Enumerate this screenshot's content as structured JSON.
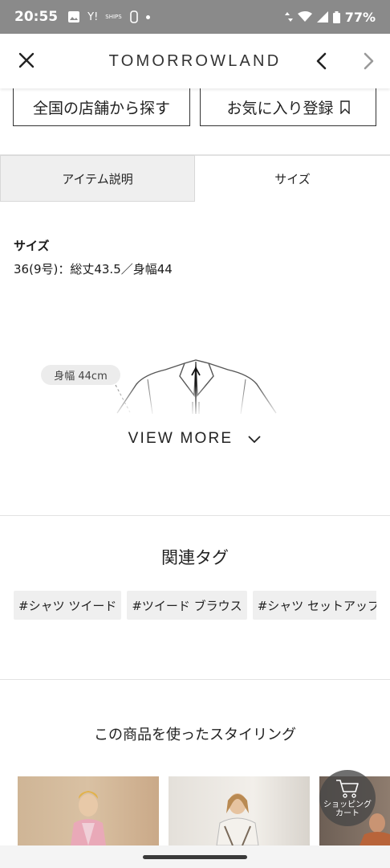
{
  "status_bar": {
    "time": "20:55",
    "apps": [
      "Y!",
      "SHIPS"
    ],
    "battery": "77%"
  },
  "header": {
    "brand": "TOMORROWLAND"
  },
  "actions": {
    "find_store": "全国の店舗から探す",
    "favorite": "お気に入り登録"
  },
  "tabs": [
    {
      "label": "アイテム説明",
      "active": false
    },
    {
      "label": "サイズ",
      "active": true
    }
  ],
  "size": {
    "heading": "サイズ",
    "value": "36(9号)：総丈43.5／身幅44",
    "width_chip": "身幅  44cm",
    "view_more": "VIEW MORE"
  },
  "related_tags": {
    "title": "関連タグ",
    "tags": [
      "#シャツ ツイード",
      "#ツイード ブラウス",
      "#シャツ セットアップ"
    ]
  },
  "styling": {
    "title": "この商品を使ったスタイリング"
  },
  "cart": {
    "label_line1": "ショッピング",
    "label_line2": "カート"
  },
  "colors": {
    "status_bar": "#8a8a8a",
    "tab_inactive_bg": "#efefef",
    "tag_bg": "#efefef"
  }
}
